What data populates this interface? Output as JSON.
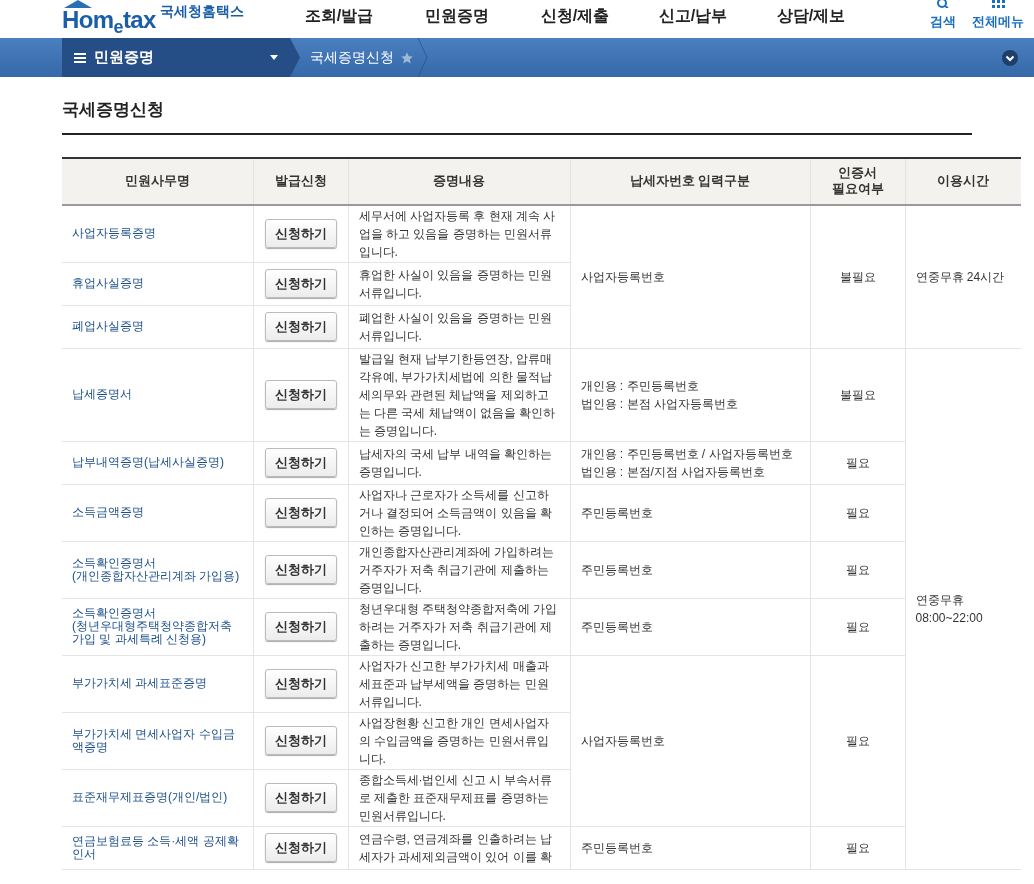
{
  "header": {
    "logo": "Hom$_{e}$tax",
    "site_name": "국세청홈택스",
    "nav": [
      "조회/발급",
      "민원증명",
      "신청/제출",
      "신고/납부",
      "상담/제보"
    ],
    "search_label": "검색",
    "all_menu_label": "전체메뉴"
  },
  "subnav": {
    "menu": "민원증명",
    "breadcrumb": "국세증명신청",
    "favorite": false
  },
  "page_title": "국세증명신청",
  "table": {
    "columns": [
      "민원사무명",
      "발급신청",
      "증명내용",
      "납세자번호 입력구분",
      "인증서\n필요여부",
      "이용시간"
    ],
    "hour_groups": [
      {
        "hours": "연중무휴 24시간",
        "input_groups": [
          {
            "input_type": "사업자등록번호",
            "certificate": "불필요",
            "services": [
              {
                "name": "사업자등록증명",
                "button": "신청하기",
                "description": "세무서에 사업자등록 후 현재 계속 사업을 하고 있음을 증명하는 민원서류입니다."
              },
              {
                "name": "휴업사실증명",
                "button": "신청하기",
                "description": "휴업한 사실이 있음을 증명하는 민원서류입니다."
              },
              {
                "name": "폐업사실증명",
                "button": "신청하기",
                "description": "폐업한 사실이 있음을 증명하는 민원서류입니다."
              }
            ]
          }
        ]
      },
      {
        "hours": "연중무휴\n08:00~22:00",
        "input_groups": [
          {
            "input_type": "개인용 : 주민등록번호\n법인용 : 본점 사업자등록번호",
            "certificate": "불필요",
            "services": [
              {
                "name": "납세증명서",
                "button": "신청하기",
                "description": "발급일 현재 납부기한등연장, 압류매각유예, 부가가치세법에 의한 물적납세의무와 관련된 체납액을 제외하고는 다른 국세 체납액이 없음을 확인하는 증명입니다."
              }
            ]
          },
          {
            "input_type": "개인용 : 주민등록번호 / 사업자등록번호\n법인용 : 본점/지점 사업자등록번호",
            "certificate": "필요",
            "services": [
              {
                "name": "납부내역증명(납세사실증명)",
                "button": "신청하기",
                "description": "납세자의 국세 납부 내역을 확인하는 증명입니다."
              }
            ]
          },
          {
            "input_type": "주민등록번호",
            "certificate": "필요",
            "services": [
              {
                "name": "소득금액증명",
                "button": "신청하기",
                "description": "사업자나 근로자가 소득세를 신고하거나 결정되어 소득금액이 있음을 확인하는 증명입니다."
              }
            ]
          },
          {
            "input_type": "주민등록번호",
            "certificate": "필요",
            "services": [
              {
                "name": "소득확인증명서\n(개인종합자산관리계좌 가입용)",
                "button": "신청하기",
                "description": "개인종합자산관리계좌에 가입하려는 거주자가 저축 취급기관에 제출하는 증명입니다."
              }
            ]
          },
          {
            "input_type": "주민등록번호",
            "certificate": "필요",
            "services": [
              {
                "name": "소득확인증명서\n(청년우대형주택청약종합저축 가입 및 과세특례 신청용)",
                "button": "신청하기",
                "description": "청년우대형 주택청약종합저축에 가입하려는 거주자가 저축 취급기관에 제출하는 증명입니다."
              }
            ]
          },
          {
            "input_type": "사업자등록번호",
            "certificate": "필요",
            "services": [
              {
                "name": "부가가치세 과세표준증명",
                "button": "신청하기",
                "description": "사업자가 신고한 부가가치세 매출과세표준과 납부세액을 증명하는 민원서류입니다."
              },
              {
                "name": "부가가치세 면세사업자 수입금액증명",
                "button": "신청하기",
                "description": "사업장현황 신고한 개인 면세사업자의 수입금액을 증명하는 민원서류입니다."
              },
              {
                "name": "표준재무제표증명(개인/법인)",
                "button": "신청하기",
                "description": "종합소득세·법인세 신고 시 부속서류로 제출한 표준재무제표를 증명하는 민원서류입니다."
              }
            ]
          },
          {
            "input_type": "주민등록번호",
            "certificate": "필요",
            "services": [
              {
                "name": "연금보험료등 소득·세액 공제확인서",
                "button": "신청하기",
                "description": "연금수령, 연금계좌를 인출하려는 납세자가 과세제외금액이 있어 이를 확"
              }
            ]
          }
        ]
      }
    ]
  }
}
